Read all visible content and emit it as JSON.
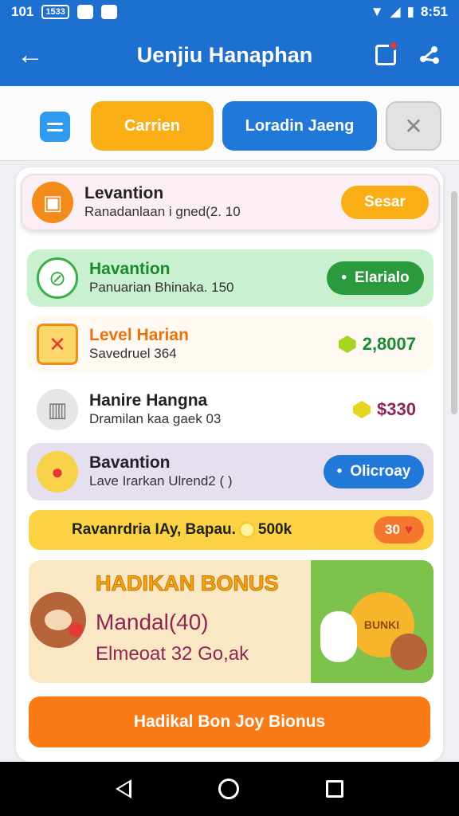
{
  "status_bar": {
    "time_left": "101",
    "box_text": "1533",
    "time_right": "8:51"
  },
  "app_bar": {
    "title": "Uenjiu Hanaphan"
  },
  "tabs": [
    {
      "label": "Carrien"
    },
    {
      "label": "Loradin Jaeng"
    },
    {
      "label": ""
    }
  ],
  "rows": [
    {
      "title": "Levantion",
      "subtitle": "Ranadanlaan i gned(2. 10",
      "action": "Sesar"
    },
    {
      "title": "Havantion",
      "subtitle": "Panuarian Bhinaka. 150",
      "action": "Elarialo"
    },
    {
      "title": "Level Harian",
      "subtitle": "Savedruel 364",
      "reward": "2,8007"
    },
    {
      "title": "Hanire Hangna",
      "subtitle": "Dramilan kaa gaek 03",
      "reward": "$330"
    },
    {
      "title": "Bavantion",
      "subtitle": "Lave Irarkan Ulrend2 ( )",
      "action": "Olicroay"
    }
  ],
  "coin_bar": {
    "text": "Ravanrdria IAy, Bapau.",
    "amount": "500k",
    "badge": "30"
  },
  "bonus": {
    "title": "HADIKAN BONUS",
    "line1": "Mandal(40)",
    "line2": "Elmeoat 32 Go,ak",
    "art_label": "BUNKI"
  },
  "cta": {
    "label": "Hadikal Bon Joy Bionus"
  },
  "colors": {
    "primary": "#1d6fd0",
    "accent_orange": "#f9ae16",
    "cta": "#f97a16"
  }
}
